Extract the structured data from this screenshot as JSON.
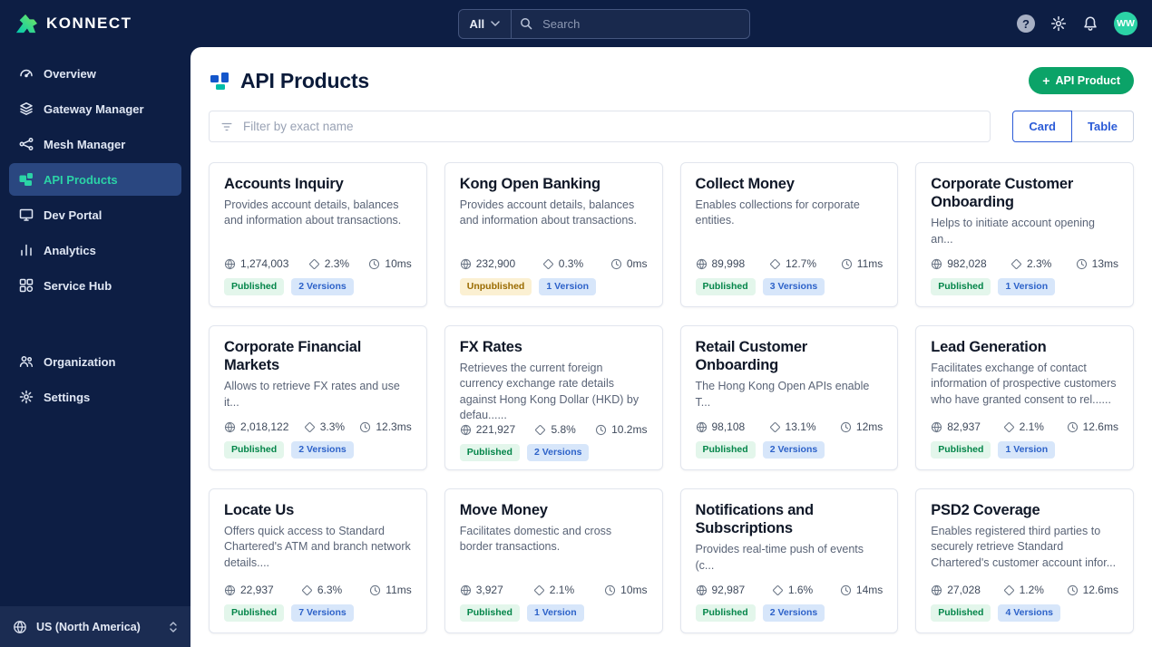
{
  "brand": {
    "name": "KONNECT"
  },
  "topbar": {
    "scope_label": "All",
    "search_placeholder": "Search",
    "help_label": "?",
    "avatar_initials": "WW"
  },
  "sidebar": {
    "items": [
      {
        "label": "Overview",
        "icon": "overview-icon",
        "active": false
      },
      {
        "label": "Gateway Manager",
        "icon": "gateway-icon",
        "active": false
      },
      {
        "label": "Mesh Manager",
        "icon": "mesh-icon",
        "active": false
      },
      {
        "label": "API Products",
        "icon": "api-products-icon",
        "active": true
      },
      {
        "label": "Dev Portal",
        "icon": "dev-portal-icon",
        "active": false
      },
      {
        "label": "Analytics",
        "icon": "analytics-icon",
        "active": false
      },
      {
        "label": "Service Hub",
        "icon": "service-hub-icon",
        "active": false
      }
    ],
    "secondary_items": [
      {
        "label": "Organization",
        "icon": "organization-icon",
        "active": false
      },
      {
        "label": "Settings",
        "icon": "settings-icon",
        "active": false
      }
    ],
    "region": {
      "label": "US (North America)"
    }
  },
  "main": {
    "title": "API Products",
    "create_button": "API Product",
    "filter_placeholder": "Filter by exact name",
    "view_toggle": {
      "card": "Card",
      "table": "Table",
      "selected": "Card"
    },
    "cards": [
      {
        "title": "Accounts Inquiry",
        "description": "Provides account details, balances and information about transactions.",
        "traffic": "1,274,003",
        "error_rate": "2.3%",
        "latency": "10ms",
        "status": "Published",
        "versions": "2 Versions"
      },
      {
        "title": "Kong Open Banking",
        "description": "Provides account details, balances and information about transactions.",
        "traffic": "232,900",
        "error_rate": "0.3%",
        "latency": "0ms",
        "status": "Unpublished",
        "versions": "1 Version"
      },
      {
        "title": "Collect Money",
        "description": "Enables collections for corporate entities.",
        "traffic": "89,998",
        "error_rate": "12.7%",
        "latency": "11ms",
        "status": "Published",
        "versions": "3 Versions"
      },
      {
        "title": "Corporate Customer Onboarding",
        "description": "Helps to initiate account opening an...",
        "traffic": "982,028",
        "error_rate": "2.3%",
        "latency": "13ms",
        "status": "Published",
        "versions": "1 Version"
      },
      {
        "title": "Corporate Financial Markets",
        "description": "Allows to retrieve FX rates and use it...",
        "traffic": "2,018,122",
        "error_rate": "3.3%",
        "latency": "12.3ms",
        "status": "Published",
        "versions": "2 Versions"
      },
      {
        "title": "FX Rates",
        "description": "Retrieves the current foreign currency exchange rate details against Hong Kong Dollar (HKD) by defau......",
        "traffic": "221,927",
        "error_rate": "5.8%",
        "latency": "10.2ms",
        "status": "Published",
        "versions": "2 Versions"
      },
      {
        "title": "Retail Customer Onboarding",
        "description": "The Hong Kong Open APIs enable T...",
        "traffic": "98,108",
        "error_rate": "13.1%",
        "latency": "12ms",
        "status": "Published",
        "versions": "2 Versions"
      },
      {
        "title": "Lead Generation",
        "description": "Facilitates exchange of contact information of prospective customers who have granted consent to rel......",
        "traffic": "82,937",
        "error_rate": "2.1%",
        "latency": "12.6ms",
        "status": "Published",
        "versions": "1 Version"
      },
      {
        "title": "Locate Us",
        "description": "Offers quick access to Standard Chartered's ATM and branch network details....",
        "traffic": "22,937",
        "error_rate": "6.3%",
        "latency": "11ms",
        "status": "Published",
        "versions": "7 Versions"
      },
      {
        "title": "Move Money",
        "description": "Facilitates domestic and cross border transactions.",
        "traffic": "3,927",
        "error_rate": "2.1%",
        "latency": "10ms",
        "status": "Published",
        "versions": "1 Version"
      },
      {
        "title": "Notifications and Subscriptions",
        "description": "Provides real-time push of events (c...",
        "traffic": "92,987",
        "error_rate": "1.6%",
        "latency": "14ms",
        "status": "Published",
        "versions": "2 Versions"
      },
      {
        "title": "PSD2 Coverage",
        "description": "Enables registered third parties to securely retrieve Standard Chartered's customer account infor...",
        "traffic": "27,028",
        "error_rate": "1.2%",
        "latency": "12.6ms",
        "status": "Published",
        "versions": "4 Versions"
      }
    ]
  },
  "colors": {
    "navy": "#0D1E44",
    "sidebar_active": "#2A4780",
    "teal": "#2BD3A6",
    "green_button": "#0BA368",
    "blue_accent": "#2B5BD7",
    "published_text": "#038549",
    "unpublished_text": "#9A6B00",
    "version_text": "#2D62C9"
  }
}
